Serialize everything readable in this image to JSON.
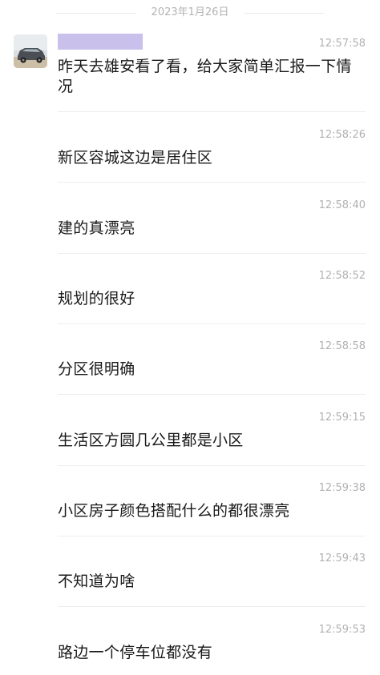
{
  "chat": {
    "date": "2023年1月26日",
    "messages": [
      {
        "time": "12:57:58",
        "text": "昨天去雄安看了看，给大家简单汇报一下情况"
      },
      {
        "time": "12:58:26",
        "text": "新区容城这边是居住区"
      },
      {
        "time": "12:58:40",
        "text": "建的真漂亮"
      },
      {
        "time": "12:58:52",
        "text": "规划的很好"
      },
      {
        "time": "12:58:58",
        "text": "分区很明确"
      },
      {
        "time": "12:59:15",
        "text": "生活区方圆几公里都是小区"
      },
      {
        "time": "12:59:38",
        "text": "小区房子颜色搭配什么的都很漂亮"
      },
      {
        "time": "12:59:43",
        "text": "不知道为啥"
      },
      {
        "time": "12:59:53",
        "text": "路边一个停车位都没有"
      }
    ]
  }
}
